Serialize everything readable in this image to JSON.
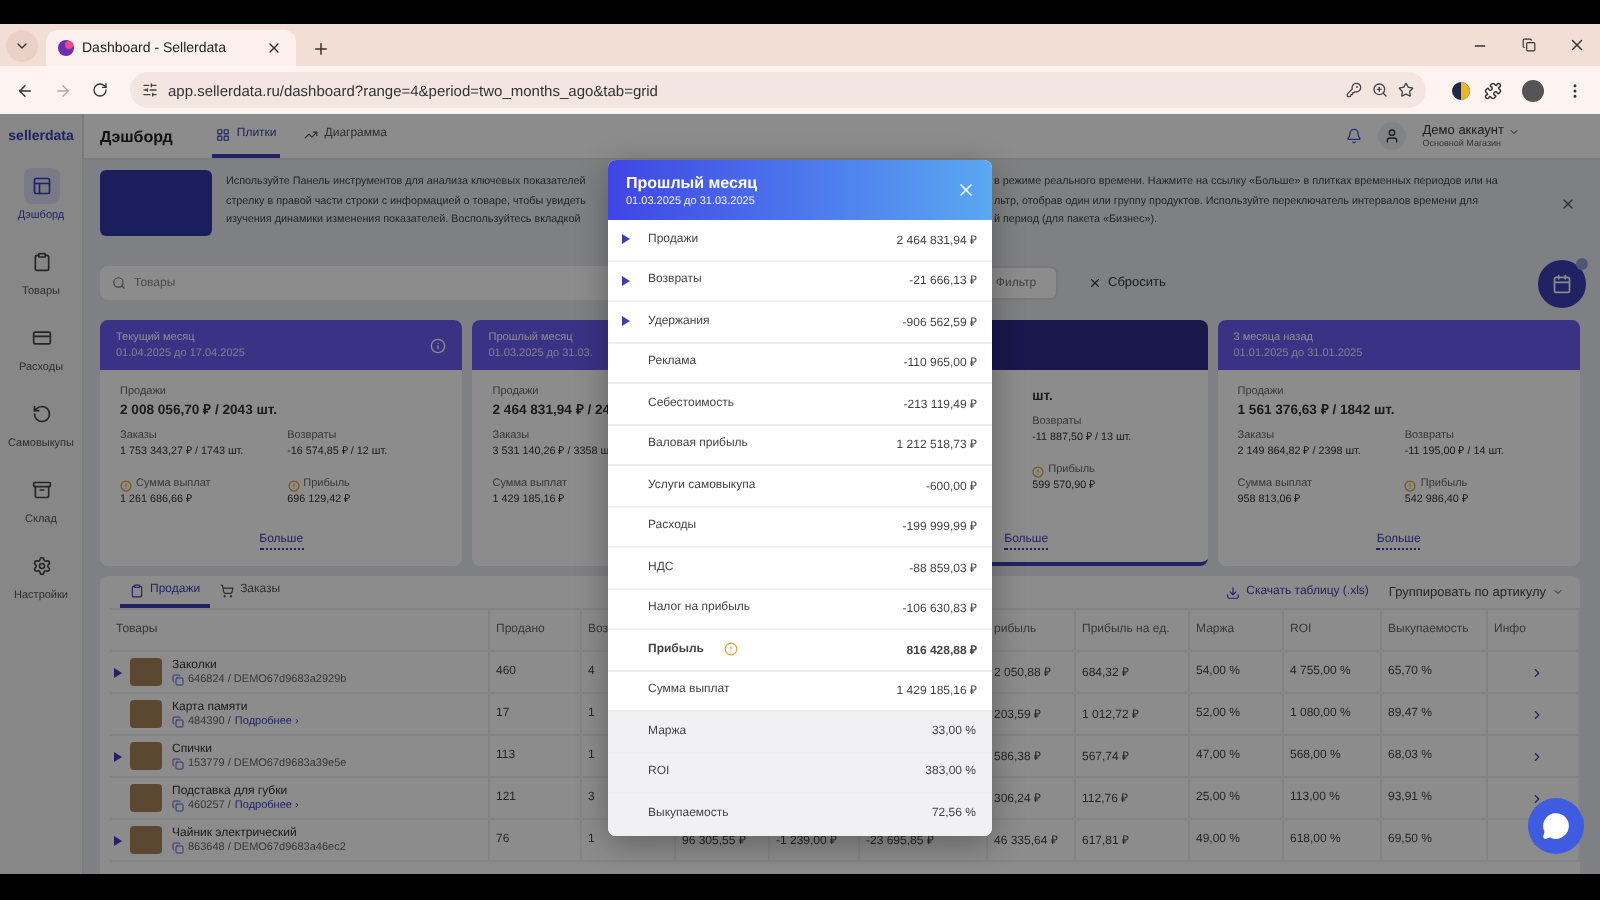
{
  "browser": {
    "tab_title": "Dashboard - Sellerdata",
    "url": "app.sellerdata.ru/dashboard?range=4&period=two_months_ago&tab=grid"
  },
  "sidebar": {
    "logo": "sellerdata",
    "items": [
      {
        "label": "Дэшборд",
        "selected": true
      },
      {
        "label": "Товары",
        "selected": false
      },
      {
        "label": "Расходы",
        "selected": false
      },
      {
        "label": "Самовыкупы",
        "selected": false
      },
      {
        "label": "Склад",
        "selected": false
      },
      {
        "label": "Настройки",
        "selected": false
      }
    ]
  },
  "header": {
    "title": "Дэшборд",
    "view_tabs": [
      {
        "label": "Плитки",
        "selected": true
      },
      {
        "label": "Диаграмма",
        "selected": false
      }
    ],
    "account": {
      "name": "Демо аккаунт",
      "store": "Основной Магазин"
    }
  },
  "banner": {
    "text_left": [
      "Используйте Панель инструментов для анализа ключевых показателей",
      "стрелку в правой части строки с информацией о товаре, чтобы увидеть",
      "изучения динамики изменения показателей. Воспользуйтесь вкладкой"
    ],
    "text_right": [
      "в режиме реального времени. Нажмите на ссылку «Больше» в плитках временных периодов или на",
      "льтр, отобрав один или группу продуктов. Используйте переключатель интервалов времени для",
      "й период (для пакета «Бизнес»)."
    ]
  },
  "filters": {
    "search_placeholder": "Товары",
    "filter_button": "Фильтр",
    "reset_button": "Сбросить"
  },
  "cards": [
    {
      "title": "Текущий месяц",
      "period": "01.04.2025 до 17.04.2025",
      "info": true,
      "selected": false,
      "rows": [
        {
          "kind": "headline",
          "cells": [
            {
              "label": "Продажи",
              "value": "2 008 056,70 ₽ / 2043 шт.",
              "warning": false
            },
            null
          ]
        },
        {
          "kind": "pair",
          "cells": [
            {
              "label": "Заказы",
              "value": "1 753 343,27 ₽ / 1743 шт.",
              "warning": false
            },
            {
              "label": "Возвраты",
              "value": "-16 574,85 ₽ / 12 шт.",
              "warning": false
            }
          ]
        },
        {
          "kind": "pair",
          "cells": [
            {
              "label": "Сумма выплат",
              "value": "1 261 686,66 ₽",
              "warning": true
            },
            {
              "label": "Прибыль",
              "value": "696 129,42 ₽",
              "warning": true
            }
          ]
        }
      ],
      "more": "Больше"
    },
    {
      "title": "Прошлый месяц",
      "period": "01.03.2025 до 31.03.",
      "selected": false,
      "rows": [
        {
          "kind": "headline",
          "cells": [
            {
              "label": "Продажи",
              "value": "2 464 831,94 ₽ / 24",
              "warning": false
            },
            null
          ]
        },
        {
          "kind": "pair",
          "cells": [
            {
              "label": "Заказы",
              "value": "3 531 140,26 ₽ / 3358 ш",
              "warning": false
            },
            null
          ]
        },
        {
          "kind": "pair",
          "cells": [
            {
              "label": "Сумма выплат",
              "value": "1 429 185,16 ₽",
              "warning": false
            },
            null
          ]
        }
      ]
    },
    {
      "selected": true,
      "rows": [
        {
          "kind": "headline",
          "cells": [
            null,
            {
              "value": "шт.",
              "warning": false
            }
          ]
        },
        {
          "kind": "pair",
          "cells": [
            null,
            {
              "label": "Возвраты",
              "value": "-11 887,50 ₽ / 13 шт.",
              "warning": false
            }
          ]
        },
        {
          "kind": "pair",
          "cells": [
            null,
            {
              "label": "Прибыль",
              "value": "599 570,90 ₽",
              "warning": true
            }
          ]
        }
      ],
      "more": "Больше"
    },
    {
      "title": "3 месяца назад",
      "period": "01.01.2025 до 31.01.2025",
      "info": false,
      "selected": false,
      "rows": [
        {
          "kind": "headline",
          "cells": [
            {
              "label": "Продажи",
              "value": "1 561 376,63 ₽ / 1842 шт.",
              "warning": false
            },
            null
          ]
        },
        {
          "kind": "pair",
          "cells": [
            {
              "label": "Заказы",
              "value": "2 149 864,82 ₽ / 2398 шт.",
              "warning": false
            },
            {
              "label": "Возвраты",
              "value": "-11 195,00 ₽ / 14 шт.",
              "warning": false
            }
          ]
        },
        {
          "kind": "pair",
          "cells": [
            {
              "label": "Сумма выплат",
              "value": "958 813,06 ₽",
              "warning": false
            },
            {
              "label": "Прибыль",
              "value": "542 986,40 ₽",
              "warning": true
            }
          ]
        }
      ],
      "more": "Больше"
    }
  ],
  "table": {
    "tabs": [
      {
        "label": "Продажи",
        "selected": true
      },
      {
        "label": "Заказы",
        "selected": false
      }
    ],
    "download": "Скачать таблицу (.xls)",
    "group_by": "Группировать по артикулу",
    "columns": [
      "Товары",
      "Продано",
      "Воз",
      null,
      null,
      null,
      "рибыль",
      "Прибыль на ед.",
      "Маржа",
      "ROI",
      "Выкупаемость",
      "Инфо"
    ],
    "rows": [
      {
        "cells": [
          {
            "name": "Заколки",
            "code": "646824 / DEMO67d9683a2929b",
            "expandable": true
          },
          "460",
          "4",
          null,
          null,
          null,
          "2 050,88 ₽",
          "684,32 ₽",
          "54,00 %",
          "4 755,00 %",
          "65,70 %",
          null
        ]
      },
      {
        "cells": [
          {
            "name": "Карта памяти",
            "code": "484390 /",
            "link": "Подробнее ›",
            "expandable": false
          },
          "17",
          "1",
          null,
          null,
          null,
          "203,59 ₽",
          "1 012,72 ₽",
          "52,00 %",
          "1 080,00 %",
          "89,47 %",
          null
        ]
      },
      {
        "cells": [
          {
            "name": "Спички",
            "code": "153779 / DEMO67d9683a39e5e",
            "expandable": true
          },
          "113",
          "1",
          null,
          null,
          null,
          "586,38 ₽",
          "567,74 ₽",
          "47,00 %",
          "568,00 %",
          "68,03 %",
          null
        ]
      },
      {
        "cells": [
          {
            "name": "Подставка для губки",
            "code": "460257 /",
            "link": "Подробнее ›",
            "expandable": false
          },
          "121",
          "3",
          null,
          null,
          null,
          "306,24 ₽",
          "112,76 ₽",
          "25,00 %",
          "113,00 %",
          "93,91 %",
          null
        ]
      },
      {
        "cells": [
          {
            "name": "Чайник электрический",
            "code": "863648 / DEMO67d9683a46ec2",
            "expandable": true
          },
          "76",
          "1",
          "96 305,55 ₽",
          "-1 239,00 ₽",
          "-23 695,85 ₽",
          "46 335,64 ₽",
          "617,81 ₽",
          "49,00 %",
          "618,00 %",
          "69,50 %",
          null
        ]
      }
    ]
  },
  "modal": {
    "title": "Прошлый месяц",
    "period": "01.03.2025 до 31.03.2025",
    "rows": [
      {
        "kind": "expandable",
        "label": "Продажи",
        "value": "2 464 831,94 ₽"
      },
      {
        "kind": "expandable",
        "label": "Возвраты",
        "value": "-21 666,13 ₽"
      },
      {
        "kind": "expandable",
        "label": "Удержания",
        "value": "-906 562,59 ₽"
      },
      {
        "kind": "plain",
        "label": "Реклама",
        "value": "-110 965,00 ₽"
      },
      {
        "kind": "plain",
        "label": "Себестоимость",
        "value": "-213 119,49 ₽"
      },
      {
        "kind": "plain",
        "label": "Валовая прибыль",
        "value": "1 212 518,73 ₽"
      },
      {
        "kind": "plain",
        "label": "Услуги самовыкупа",
        "value": "-600,00 ₽"
      },
      {
        "kind": "plain",
        "label": "Расходы",
        "value": "-199 999,99 ₽"
      },
      {
        "kind": "plain",
        "label": "НДС",
        "value": "-88 859,03 ₽"
      },
      {
        "kind": "plain",
        "label": "Налог на прибыль",
        "value": "-106 630,83 ₽"
      },
      {
        "kind": "total",
        "label": "Прибыль",
        "value": "816 428,88 ₽"
      },
      {
        "kind": "plain",
        "label": "Сумма выплат",
        "value": "1 429 185,16 ₽"
      },
      {
        "kind": "ratio",
        "label": "Маржа",
        "value": "33,00 %"
      },
      {
        "kind": "ratio",
        "label": "ROI",
        "value": "383,00 %"
      },
      {
        "kind": "ratio",
        "label": "Выкупаемость",
        "value": "72,56 %"
      }
    ]
  }
}
